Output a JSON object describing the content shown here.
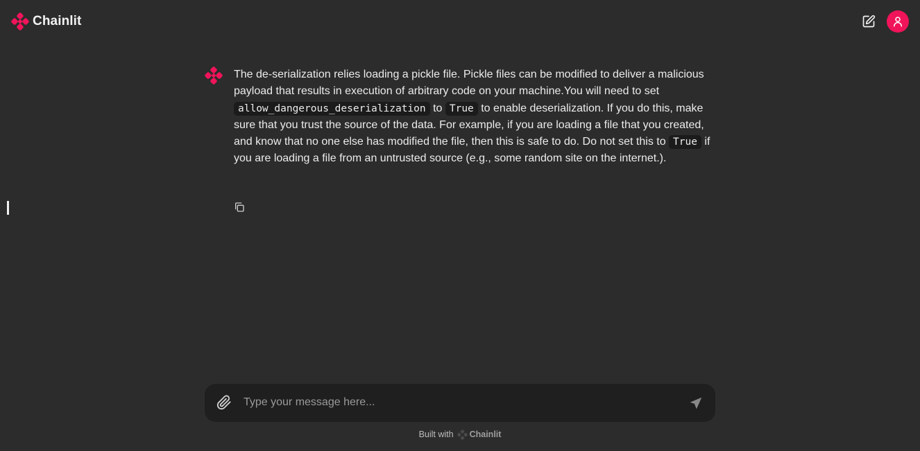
{
  "app": {
    "name": "Chainlit",
    "accent_color": "#f0145a"
  },
  "header": {
    "logo_text": "Chainlit",
    "new_chat_icon": "edit-icon",
    "user_icon": "user-icon"
  },
  "message": {
    "author_icon": "chainlit-logo-icon",
    "parts": {
      "p1": "The de-serialization relies loading a pickle file. Pickle files can be modified to deliver a malicious payload that results in execution of arbitrary code on your machine.You will need to set ",
      "code1": "allow_dangerous_deserialization",
      "p2": " to ",
      "code2": "True",
      "p3": " to enable deserialization. If you do this, make sure that you trust the source of the data. For example, if you are loading a file that you created, and know that no one else has modified the file, then this is safe to do. Do not set this to ",
      "code3": "True",
      "p4": " if you are loading a file from an untrusted source (e.g., some random site on the internet.)."
    },
    "copy_icon": "copy-icon"
  },
  "composer": {
    "placeholder": "Type your message here...",
    "value": "",
    "attach_icon": "paperclip-icon",
    "send_icon": "send-icon"
  },
  "footer": {
    "built_with": "Built with",
    "brand": "Chainlit"
  }
}
